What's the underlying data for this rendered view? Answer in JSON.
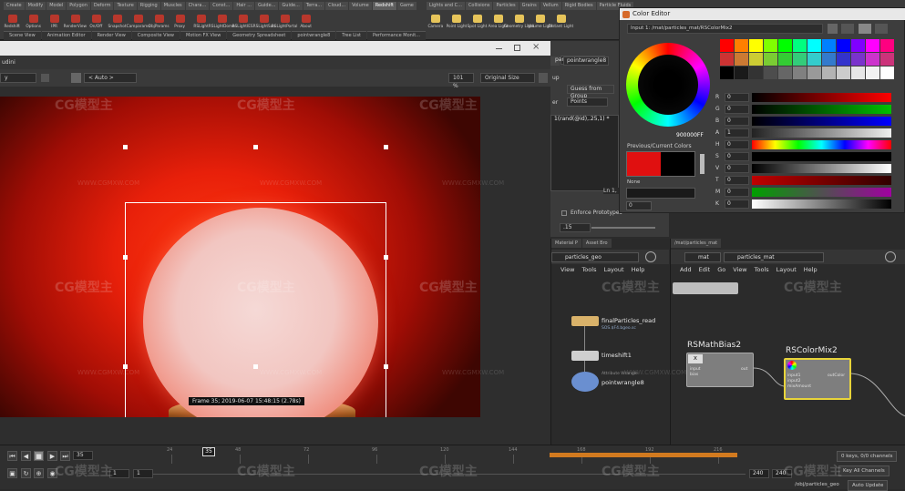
{
  "shelf": {
    "tabs_left": [
      "Create",
      "Modify",
      "Model",
      "Polygon",
      "Deform",
      "Texture",
      "Rigging",
      "Muscles",
      "Chara...",
      "Const...",
      "Hair ...",
      "Guide...",
      "Guide...",
      "Terra...",
      "Cloud...",
      "Volume",
      "Redshift",
      "Game"
    ],
    "active_tab": "Redshift",
    "tabs_right": [
      "Lights and C...",
      "Collisions",
      "Particles",
      "Grains",
      "Vellum",
      "Rigid Bodies",
      "Particle Fluids"
    ],
    "tools_left": [
      "Redshift",
      "Options",
      "IPR",
      "RenderView",
      "On/Off",
      "Snapshot",
      "Camparams",
      "ObjParams",
      "Proxy",
      "RSLight",
      "RSLightDome",
      "RSLightIES",
      "RSLightSun",
      "RSLightPortal",
      "About"
    ],
    "tools_right": [
      "Camera",
      "Point Light",
      "Spot Light",
      "Area Light",
      "Geometry Light",
      "Volume Light",
      "Distant Light"
    ],
    "pane_tabs": [
      "Scene View",
      "Animation Editor",
      "Render View",
      "Composite View",
      "Motion FX View",
      "Geometry Spreadsheet",
      "pointwrangle8",
      "Tree List",
      "Performance Monit..."
    ]
  },
  "viewer": {
    "app_title": "udini",
    "dropdown": "y",
    "auto_label": "< Auto >",
    "zoom": "101 %",
    "size_mode": "Original Size",
    "frame_info": "Frame  35;  2019-06-07  15:48:15  (2.78s)"
  },
  "params": {
    "node_name": "pointwrangle8",
    "geo_name": "particles_geo",
    "up_label": "up",
    "guess_button": "Guess from Group",
    "er_label": "er",
    "points_value": "Points",
    "code": "1(rand(@id),.25,1) *",
    "enforce_label": "Enforce Prototypes",
    "value_15": ".15",
    "ln_label": "Ln 1, C"
  },
  "color_editor": {
    "title": "Color Editor",
    "path": "Input 1: /mat/particles_mat/RSColorMix2",
    "hex": "900000FF",
    "previous_current_label": "Previous/Current Colors",
    "none_label": "None",
    "previous_color": "#e01010",
    "current_color": "#000000",
    "swatch_rows": [
      [
        "#ff0000",
        "#ff7f00",
        "#ffff00",
        "#80ff00",
        "#00ff00",
        "#00ff80",
        "#00ffff",
        "#0080ff",
        "#0000ff",
        "#8000ff",
        "#ff00ff",
        "#ff0080"
      ],
      [
        "#cc3333",
        "#cc7a33",
        "#cccc33",
        "#7acc33",
        "#33cc33",
        "#33cc7a",
        "#33cccc",
        "#337acc",
        "#3333cc",
        "#7a33cc",
        "#cc33cc",
        "#cc337a"
      ],
      [
        "#000000",
        "#1a1a1a",
        "#333333",
        "#4d4d4d",
        "#666666",
        "#808080",
        "#999999",
        "#b3b3b3",
        "#cccccc",
        "#e6e6e6",
        "#f2f2f2",
        "#ffffff"
      ]
    ],
    "sliders": [
      {
        "label": "R",
        "value": "0",
        "grad": "linear-gradient(90deg,#000,#ff0000)"
      },
      {
        "label": "G",
        "value": "0",
        "grad": "linear-gradient(90deg,#000,#00c000)"
      },
      {
        "label": "B",
        "value": "0",
        "grad": "linear-gradient(90deg,#000,#0000ff)"
      },
      {
        "label": "A",
        "value": "1",
        "grad": "linear-gradient(90deg,#222,#eee)"
      },
      {
        "label": "H",
        "value": "0",
        "grad": "linear-gradient(90deg,#f00,#ff0,#0f0,#0ff,#00f,#f0f,#f00)"
      },
      {
        "label": "S",
        "value": "0",
        "grad": "linear-gradient(90deg,#000,#000)"
      },
      {
        "label": "V",
        "value": "0",
        "grad": "linear-gradient(90deg,#000,#fff)"
      },
      {
        "label": "T",
        "value": "0",
        "grad": "linear-gradient(90deg,#c00000,#300000)"
      },
      {
        "label": "M",
        "value": "0",
        "grad": "linear-gradient(90deg,#00a000,#a000a0)"
      },
      {
        "label": "K",
        "value": "0",
        "grad": "linear-gradient(90deg,#fff,#000)"
      }
    ]
  },
  "net_left": {
    "tabs": [
      "Material P",
      "Asset Bro"
    ],
    "path": "particles_geo",
    "menu": [
      "View",
      "Tools",
      "Layout",
      "Help"
    ],
    "nodes": [
      {
        "label": "finalParticles_read",
        "sub": "SOS.$F4.bgeo.sc"
      },
      {
        "label": "timeshift1",
        "sub": ""
      },
      {
        "label": "pointwrangle8",
        "sub": "Attribute Wrangle"
      }
    ]
  },
  "net_right": {
    "path_top": "/mat/particles_mat",
    "path": "particles_mat",
    "mat_label": "mat",
    "menu": [
      "Add",
      "Edit",
      "Go",
      "View",
      "Tools",
      "Layout",
      "Help"
    ],
    "node1_title": "RSMathBias2",
    "node1_ports": [
      "input",
      "bias"
    ],
    "node1_out": "out",
    "node2_title": "RSColorMix2",
    "node2_ports": [
      "input1",
      "input2",
      "mixAmount"
    ],
    "node2_out": "outColor"
  },
  "timeline": {
    "current_frame": "35",
    "frame_field": "35",
    "ticks": [
      "24",
      "48",
      "72",
      "96",
      "120",
      "144",
      "168",
      "192",
      "216"
    ],
    "start_field": "1",
    "start_field2": "1",
    "end_field": "240",
    "end_field2": "240",
    "keys_label": "0 keys, 0/0 channels",
    "key_all": "Key All Channels",
    "path_bottom": "/obj/particles_geo",
    "auto_update": "Auto Update"
  },
  "watermarks": {
    "logo": "CG模型主",
    "url": "WWW.CGMXW.COM"
  }
}
